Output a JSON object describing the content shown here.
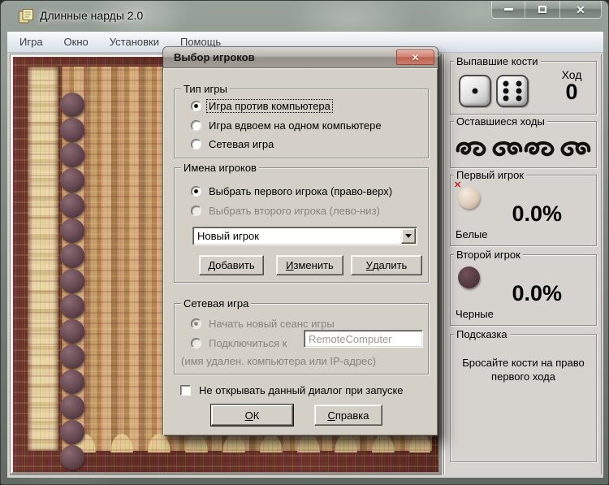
{
  "window": {
    "title": "Длинные нарды 2.0",
    "close_glyph": "✕"
  },
  "menu": {
    "items": [
      {
        "label": "Игра"
      },
      {
        "label": "Окно"
      },
      {
        "label": "Установки"
      },
      {
        "label": "Помощь"
      }
    ]
  },
  "board": {
    "checker_count": 15,
    "checker_color": "dark-brown"
  },
  "dialog": {
    "title": "Выбор игроков",
    "close_glyph": "✕",
    "groups": {
      "game_type": {
        "caption": "Тип игры",
        "options": [
          {
            "label": "Игра против компьютера",
            "selected": true
          },
          {
            "label": "Игра вдвоем на одном компьютере",
            "selected": false
          },
          {
            "label": "Сетевая игра",
            "selected": false
          }
        ]
      },
      "player_names": {
        "caption": "Имена игроков",
        "options": [
          {
            "label": "Выбрать первого игрока (право-верх)",
            "selected": true
          },
          {
            "label": "Выбрать второго игрока (лево-низ)",
            "selected": false,
            "disabled": true
          }
        ],
        "combo_value": "Новый игрок",
        "buttons": [
          {
            "label": "Добавить"
          },
          {
            "label": "Изменить"
          },
          {
            "label": "Удалить"
          }
        ]
      },
      "network": {
        "caption": "Сетевая игра",
        "options": [
          {
            "label": "Начать новый сеанс игры",
            "selected": true,
            "disabled": true
          },
          {
            "label": "Подключиться к",
            "selected": false,
            "disabled": true
          }
        ],
        "host_value": "RemoteComputer",
        "note": "(имя удален. компьютера или IP-адрес)"
      }
    },
    "startup_checkbox": "Не открывать данный диалог при запуске",
    "ok_label": "ОК",
    "help_label": "Справка"
  },
  "panel": {
    "dice": {
      "caption": "Выпавшие кости",
      "die1": 1,
      "die2": 6,
      "move_label": "Ход",
      "move_value": "0"
    },
    "remaining": {
      "caption": "Оставшиеся ходы"
    },
    "player1": {
      "caption": "Первый игрок",
      "percent": "0.0%",
      "color_label": "Белые",
      "marker_glyph": "✕"
    },
    "player2": {
      "caption": "Второй игрок",
      "percent": "0.0%",
      "color_label": "Черные"
    },
    "hint": {
      "caption": "Подсказка",
      "text": "Бросайте кости на право первого хода"
    }
  },
  "colors": {
    "dialog_bg": "#d4d0c8",
    "panel_bg": "#d6d3ce",
    "close_button": "#c9776a",
    "board_frame": "#63302a",
    "board_field": "#c49868",
    "checker_dark": "#5f444c",
    "checker_light": "#e8d9c8"
  }
}
